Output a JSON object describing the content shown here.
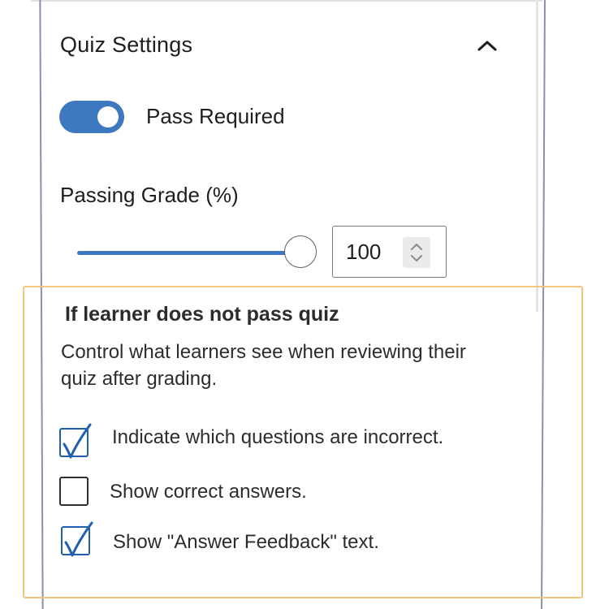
{
  "quiz_settings": {
    "title": "Quiz Settings",
    "collapse_icon": "chevron-up-icon",
    "pass_required": {
      "label": "Pass Required",
      "enabled": true
    },
    "passing_grade": {
      "label": "Passing Grade (%)",
      "value": "100",
      "slider_percent": 100
    }
  },
  "fail_options": {
    "title": "If learner does not pass quiz",
    "description": "Control what learners see when reviewing their quiz after grading.",
    "options": [
      {
        "label": "Indicate which questions are incorrect.",
        "checked": true
      },
      {
        "label": "Show correct answers.",
        "checked": false
      },
      {
        "label": "Show \"Answer Feedback\" text.",
        "checked": true
      }
    ]
  },
  "colors": {
    "accent": "#3e78c0",
    "checkbox_check": "#1f5fae",
    "highlight_border": "#f4c67b",
    "panel_border": "#8b8fa8"
  }
}
